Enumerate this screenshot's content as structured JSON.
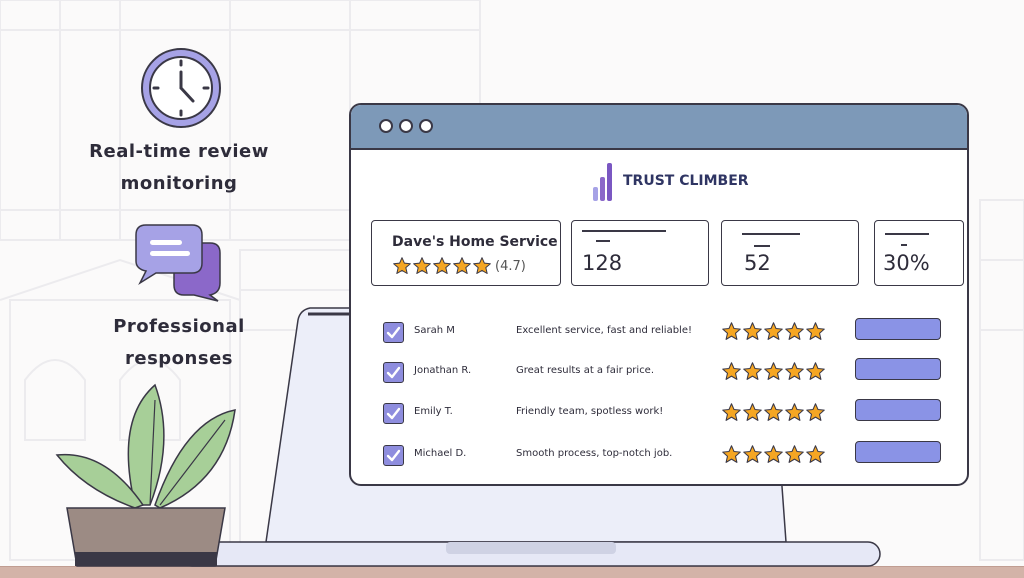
{
  "features": [
    {
      "icon": "clock-icon",
      "title_line1": "Real-time review",
      "title_line2": "monitoring"
    },
    {
      "icon": "chat-bubbles-icon",
      "title_line1": "Professional",
      "title_line2": "responses"
    }
  ],
  "brand": {
    "name": "TRUST CLIMBER"
  },
  "business": {
    "name": "Dave's Home Service",
    "stars": 5,
    "rating_text": "(4.7)"
  },
  "stats": [
    {
      "value": "128"
    },
    {
      "value": "52"
    },
    {
      "value": "30%"
    }
  ],
  "reviews": [
    {
      "name": "Sarah M",
      "text": "Excellent service, fast and reliable!",
      "stars": 5,
      "checked": true
    },
    {
      "name": "Jonathan R.",
      "text": "Great results at a fair price.",
      "stars": 5,
      "checked": true
    },
    {
      "name": "Emily T.",
      "text": "Friendly team, spotless work!",
      "stars": 5,
      "checked": true
    },
    {
      "name": "Michael D.",
      "text": "Smooth process, top-notch job.",
      "stars": 5,
      "checked": true
    }
  ],
  "colors": {
    "accent": "#8a93e6",
    "titlebar": "#7d99b8",
    "star": "#f5a623",
    "plant": "#a7cf98",
    "pot": "#9c8b84"
  }
}
